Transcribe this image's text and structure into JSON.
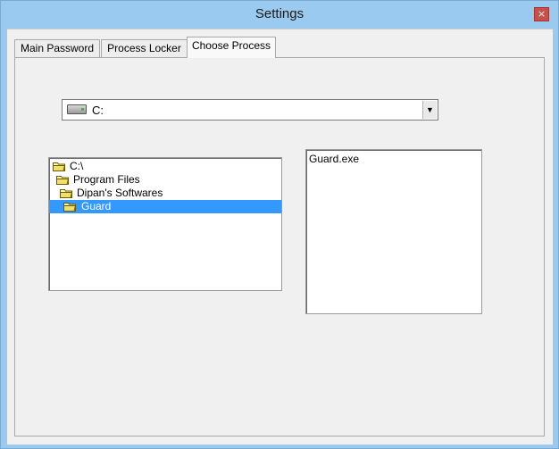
{
  "window": {
    "title": "Settings",
    "close_symbol": "×"
  },
  "tabs": [
    {
      "label": "Main Password"
    },
    {
      "label": "Process Locker"
    },
    {
      "label": "Choose Process"
    }
  ],
  "drive": {
    "value": "C:",
    "dropdown_symbol": "▼"
  },
  "tree": [
    {
      "label": "C:\\"
    },
    {
      "label": "Program Files"
    },
    {
      "label": "Dipan's Softwares"
    },
    {
      "label": "Guard"
    }
  ],
  "files": [
    {
      "label": "Guard.exe"
    }
  ],
  "colors": {
    "selection": "#3399ff",
    "titlebar": "#9bcaf0",
    "close": "#c7504a"
  }
}
